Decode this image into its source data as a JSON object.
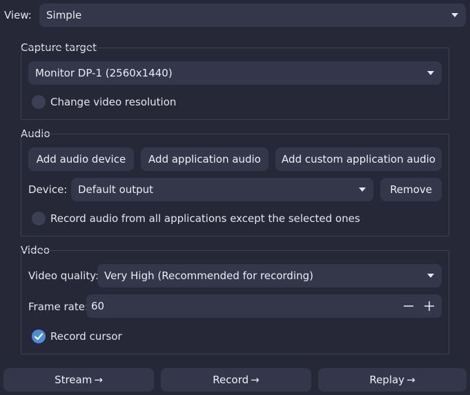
{
  "view": {
    "label": "View:",
    "value": "Simple"
  },
  "capture_target": {
    "title": "Capture target",
    "monitor": "Monitor DP-1 (2560x1440)",
    "change_resolution_label": "Change video resolution",
    "change_resolution_checked": false
  },
  "audio": {
    "title": "Audio",
    "buttons": {
      "add_device": "Add audio device",
      "add_application": "Add application audio",
      "add_custom_application": "Add custom application audio"
    },
    "device_label": "Device:",
    "device_value": "Default output",
    "remove_label": "Remove",
    "record_all_except_label": "Record audio from all applications except the selected ones",
    "record_all_except_checked": false
  },
  "video": {
    "title": "Video",
    "quality_label": "Video quality:",
    "quality_value": "Very High (Recommended for recording)",
    "frame_rate_label": "Frame rate:",
    "frame_rate_value": "60",
    "record_cursor_label": "Record cursor",
    "record_cursor_checked": true
  },
  "actions": {
    "stream": "Stream",
    "record": "Record",
    "replay": "Replay"
  },
  "colors": {
    "background": "#262838",
    "control": "#34364a",
    "accent": "#4a8ed8"
  }
}
